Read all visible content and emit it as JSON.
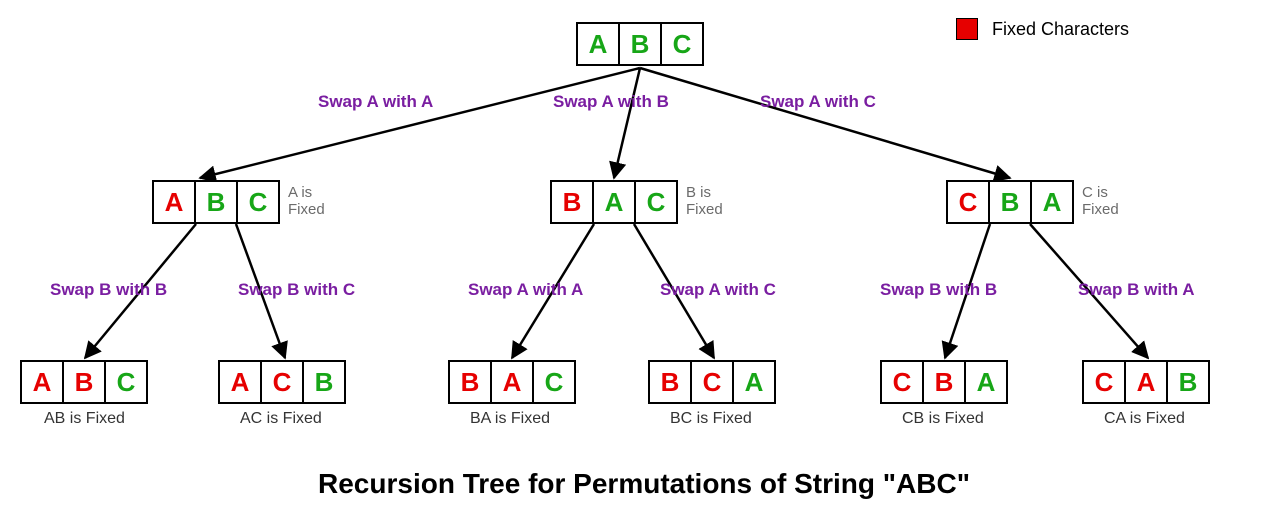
{
  "title": "Recursion Tree for Permutations of String \"ABC\"",
  "legend": {
    "label": "Fixed Characters"
  },
  "colors": {
    "fixed": "#e60000",
    "free": "#17a617",
    "swap": "#7a1ea1",
    "note": "#6b6b6b"
  },
  "root": {
    "chars": [
      "A",
      "B",
      "C"
    ],
    "fixed_count": 0
  },
  "level1": [
    {
      "swap_label": "Swap A with A",
      "chars": [
        "A",
        "B",
        "C"
      ],
      "fixed_count": 1,
      "note": "A is\nFixed"
    },
    {
      "swap_label": "Swap A with B",
      "chars": [
        "B",
        "A",
        "C"
      ],
      "fixed_count": 1,
      "note": "B is\nFixed"
    },
    {
      "swap_label": "Swap A with C",
      "chars": [
        "C",
        "B",
        "A"
      ],
      "fixed_count": 1,
      "note": "C is\nFixed"
    }
  ],
  "level2": [
    {
      "parent": 0,
      "swap_label": "Swap B with B",
      "chars": [
        "A",
        "B",
        "C"
      ],
      "fixed_count": 2,
      "result_label": "AB is Fixed"
    },
    {
      "parent": 0,
      "swap_label": "Swap B with C",
      "chars": [
        "A",
        "C",
        "B"
      ],
      "fixed_count": 2,
      "result_label": "AC is Fixed"
    },
    {
      "parent": 1,
      "swap_label": "Swap A with A",
      "chars": [
        "B",
        "A",
        "C"
      ],
      "fixed_count": 2,
      "result_label": "BA is Fixed"
    },
    {
      "parent": 1,
      "swap_label": "Swap A with C",
      "chars": [
        "B",
        "C",
        "A"
      ],
      "fixed_count": 2,
      "result_label": "BC is Fixed"
    },
    {
      "parent": 2,
      "swap_label": "Swap B with B",
      "chars": [
        "C",
        "B",
        "A"
      ],
      "fixed_count": 2,
      "result_label": "CB is Fixed"
    },
    {
      "parent": 2,
      "swap_label": "Swap B with A",
      "chars": [
        "C",
        "A",
        "B"
      ],
      "fixed_count": 2,
      "result_label": "CA is Fixed"
    }
  ]
}
